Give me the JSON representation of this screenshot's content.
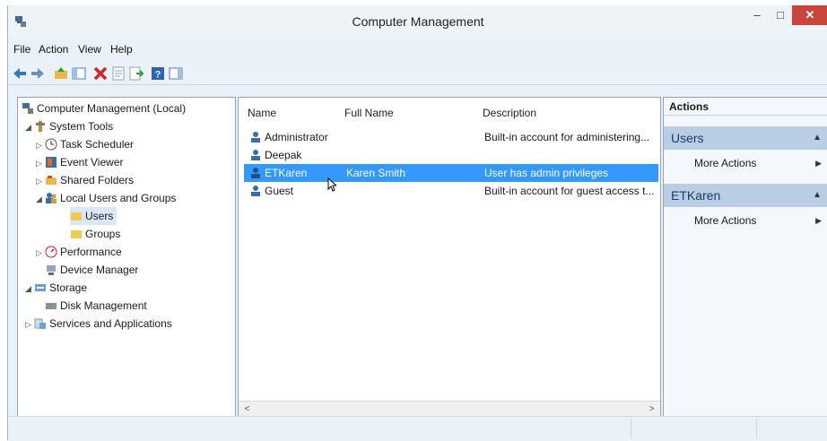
{
  "window": {
    "title": "Computer Management",
    "minimize_glyph": "–",
    "maximize_glyph": "□",
    "close_glyph": "✕"
  },
  "menu": [
    "File",
    "Action",
    "View",
    "Help"
  ],
  "toolbar_icons": [
    "back-icon",
    "forward-icon",
    "up-folder-icon",
    "show-hide-tree-icon",
    "delete-icon",
    "properties-icon",
    "export-list-icon",
    "help-icon",
    "show-hide-action-pane-icon"
  ],
  "tree": {
    "items": [
      {
        "label": "Computer Management (Local)",
        "icon": "computer-management-icon"
      },
      {
        "label": "System Tools",
        "icon": "system-tools-icon"
      },
      {
        "label": "Task Scheduler",
        "icon": "task-scheduler-icon"
      },
      {
        "label": "Event Viewer",
        "icon": "event-viewer-icon"
      },
      {
        "label": "Shared Folders",
        "icon": "shared-folders-icon"
      },
      {
        "label": "Local Users and Groups",
        "icon": "users-groups-icon"
      },
      {
        "label": "Users",
        "icon": "folder-icon"
      },
      {
        "label": "Groups",
        "icon": "folder-icon"
      },
      {
        "label": "Performance",
        "icon": "performance-icon"
      },
      {
        "label": "Device Manager",
        "icon": "device-manager-icon"
      },
      {
        "label": "Storage",
        "icon": "storage-icon"
      },
      {
        "label": "Disk Management",
        "icon": "disk-management-icon"
      },
      {
        "label": "Services and Applications",
        "icon": "services-icon"
      }
    ]
  },
  "list": {
    "columns": [
      "Name",
      "Full Name",
      "Description"
    ],
    "rows": [
      {
        "name": "Administrator",
        "full_name": "",
        "description": "Built-in account for administering..."
      },
      {
        "name": "Deepak",
        "full_name": "",
        "description": ""
      },
      {
        "name": "ETKaren",
        "full_name": "Karen Smith",
        "description": "User has admin privileges"
      },
      {
        "name": "Guest",
        "full_name": "",
        "description": "Built-in account for guest access t..."
      }
    ],
    "selected_row": "ETKaren"
  },
  "actions": {
    "header": "Actions",
    "sections": [
      {
        "title": "Users",
        "items": [
          "More Actions"
        ]
      },
      {
        "title": "ETKaren",
        "items": [
          "More Actions"
        ]
      }
    ]
  },
  "colors": {
    "selection": "#3399ff",
    "section_header": "#b9cde4",
    "close_button": "#c9463d"
  }
}
